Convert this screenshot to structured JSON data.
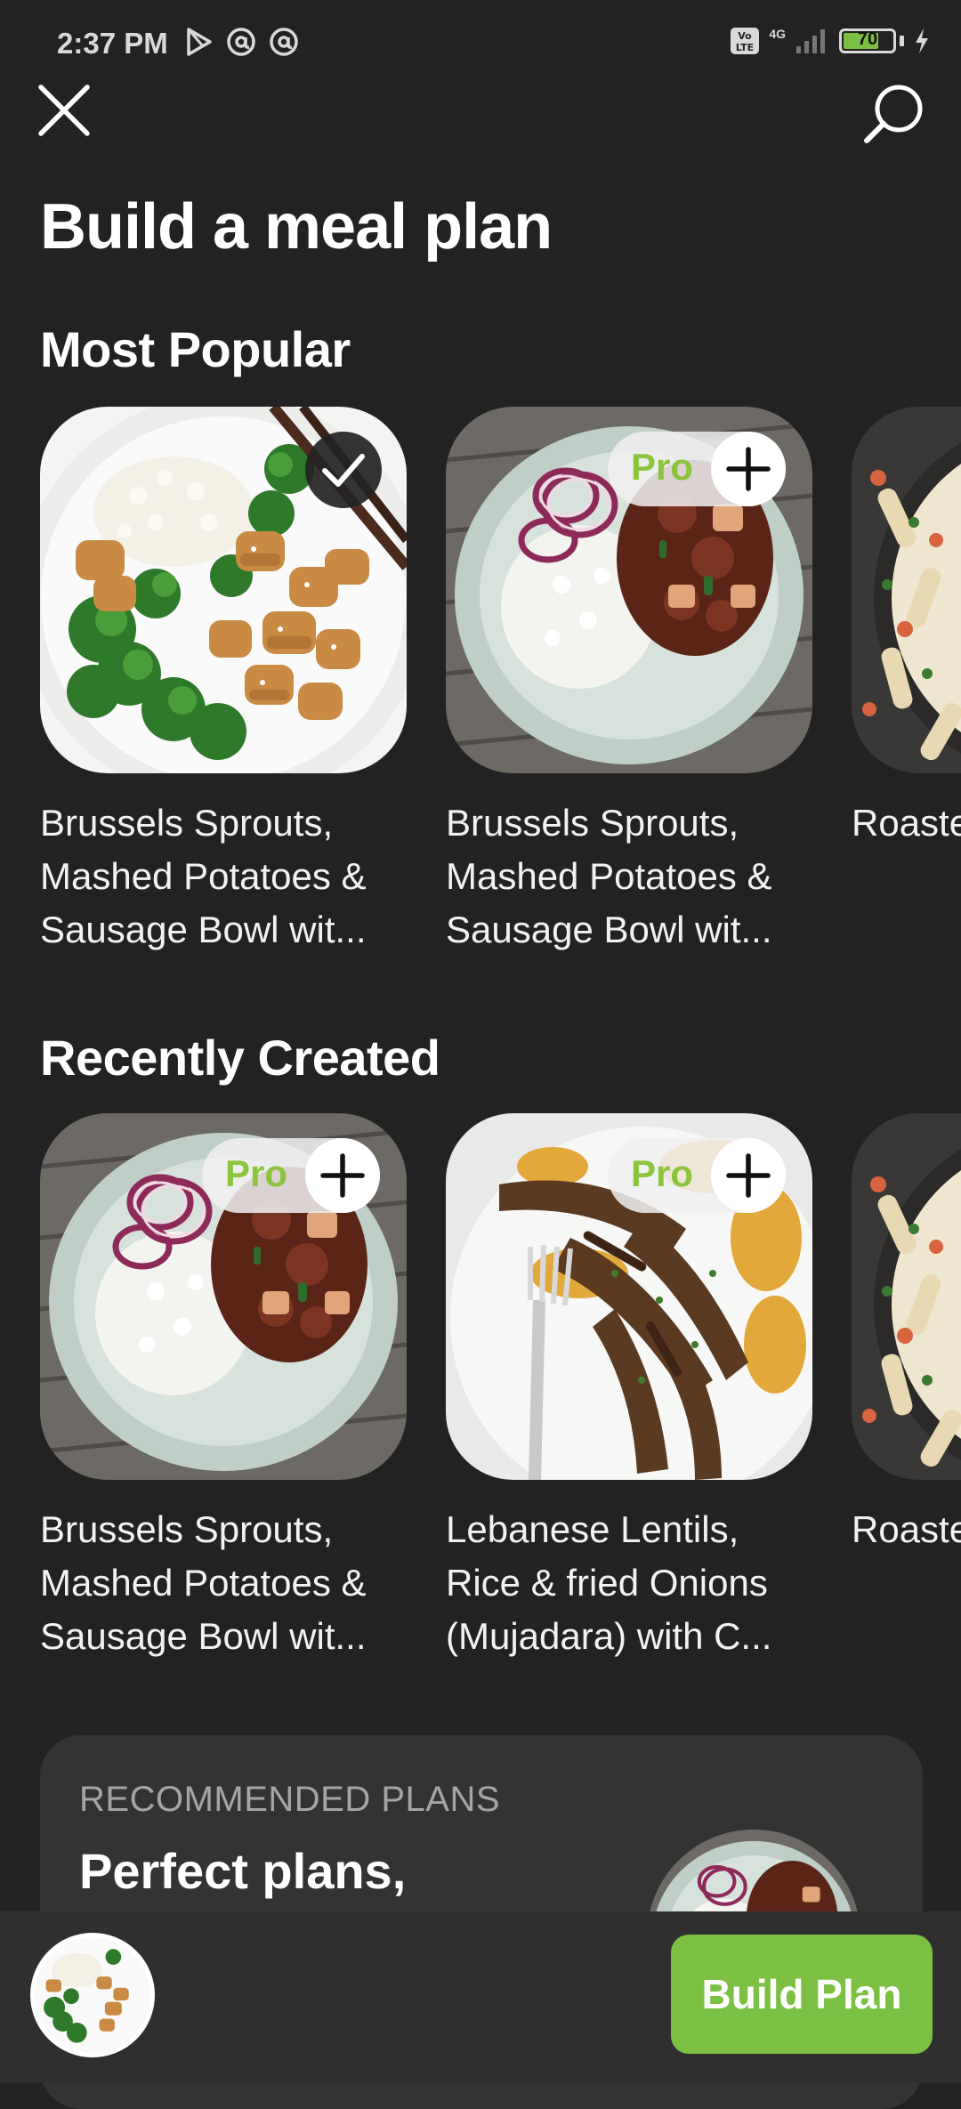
{
  "status_bar": {
    "time": "2:37 PM",
    "battery": "70",
    "network": "4G",
    "icons": [
      "play-store-icon",
      "at-icon",
      "at-icon",
      "volte-icon",
      "signal-icon",
      "battery-icon",
      "charging-icon"
    ]
  },
  "header": {
    "title": "Build a meal plan",
    "icons": [
      "close-icon",
      "search-icon"
    ]
  },
  "sections": [
    {
      "title": "Most Popular",
      "cards": [
        {
          "title": "Brussels Sprouts, Mashed Potatoes & Sausage Bowl wit...",
          "state": "selected",
          "image": "chicken-broccoli-rice-bowl"
        },
        {
          "title": "Brussels Sprouts, Mashed Potatoes & Sausage Bowl wit...",
          "state": "pro",
          "pro_label": "Pro",
          "image": "rice-stew-onion-plate"
        },
        {
          "title": "Roaste & Blac Burrito",
          "state": "none",
          "image": "creamy-pasta-pan"
        }
      ]
    },
    {
      "title": "Recently Created",
      "cards": [
        {
          "title": "Brussels Sprouts, Mashed Potatoes & Sausage Bowl wit...",
          "state": "pro",
          "pro_label": "Pro",
          "image": "rice-stew-onion-plate"
        },
        {
          "title": "Lebanese Lentils, Rice & fried Onions (Mujadara) with C...",
          "state": "pro",
          "pro_label": "Pro",
          "image": "steak-potatoes-plate"
        },
        {
          "title": "Roaste & Blac Burrito",
          "state": "none",
          "image": "creamy-pasta-pan"
        }
      ]
    }
  ],
  "recommended": {
    "label": "RECOMMENDED PLANS",
    "title": "Perfect plans,"
  },
  "bottom_bar": {
    "build_button_label": "Build Plan"
  },
  "colors": {
    "background": "#222223",
    "accent_green": "#7bc043",
    "pro_green": "#8cc43c",
    "card_background": "#333334"
  }
}
